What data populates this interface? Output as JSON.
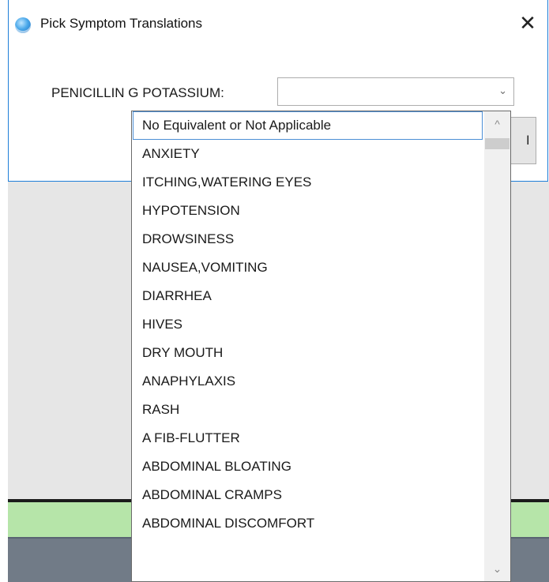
{
  "window": {
    "title": "Pick Symptom Translations",
    "close_glyph": "✕",
    "icon": "app-globe-icon"
  },
  "form": {
    "label": "PENICILLIN G POTASSIUM:",
    "combo_value": "",
    "combo_arrow": "⌄"
  },
  "hidden_button_label": "l",
  "dropdown": {
    "items": [
      "No Equivalent or Not Applicable",
      "ANXIETY",
      "ITCHING,WATERING EYES",
      "HYPOTENSION",
      "DROWSINESS",
      "NAUSEA,VOMITING",
      "DIARRHEA",
      "HIVES",
      "DRY MOUTH",
      "ANAPHYLAXIS",
      "RASH",
      "A FIB-FLUTTER",
      "ABDOMINAL BLOATING",
      "ABDOMINAL CRAMPS",
      "ABDOMINAL DISCOMFORT"
    ],
    "selected_index": 0,
    "scroll_up_glyph": "^",
    "scroll_down_glyph": "⌄"
  },
  "colors": {
    "accent_border": "#1e7fd8",
    "selection_border": "#4b8fd6",
    "green_band": "#b6e5a9",
    "slate_band": "#717b87"
  }
}
